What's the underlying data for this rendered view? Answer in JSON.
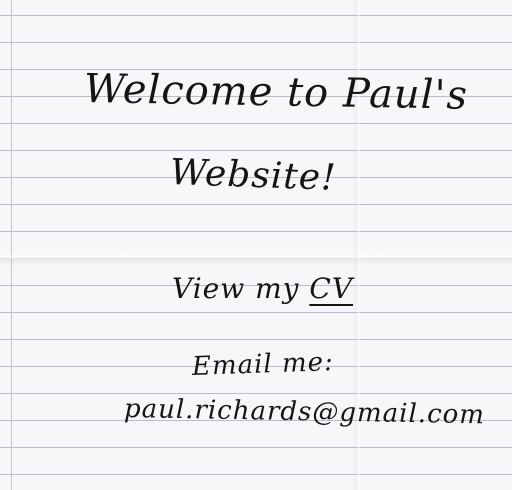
{
  "note": {
    "title_line_1": "Welcome to Paul's",
    "title_line_2": "Website!",
    "cv_prefix": "View my ",
    "cv_link": "CV",
    "email_label": "Email me:",
    "email_address": "paul.richards@gmail.com"
  },
  "colors": {
    "ink": "#151515",
    "paper": "#f7f7f9",
    "rule": "#b9bccc"
  }
}
